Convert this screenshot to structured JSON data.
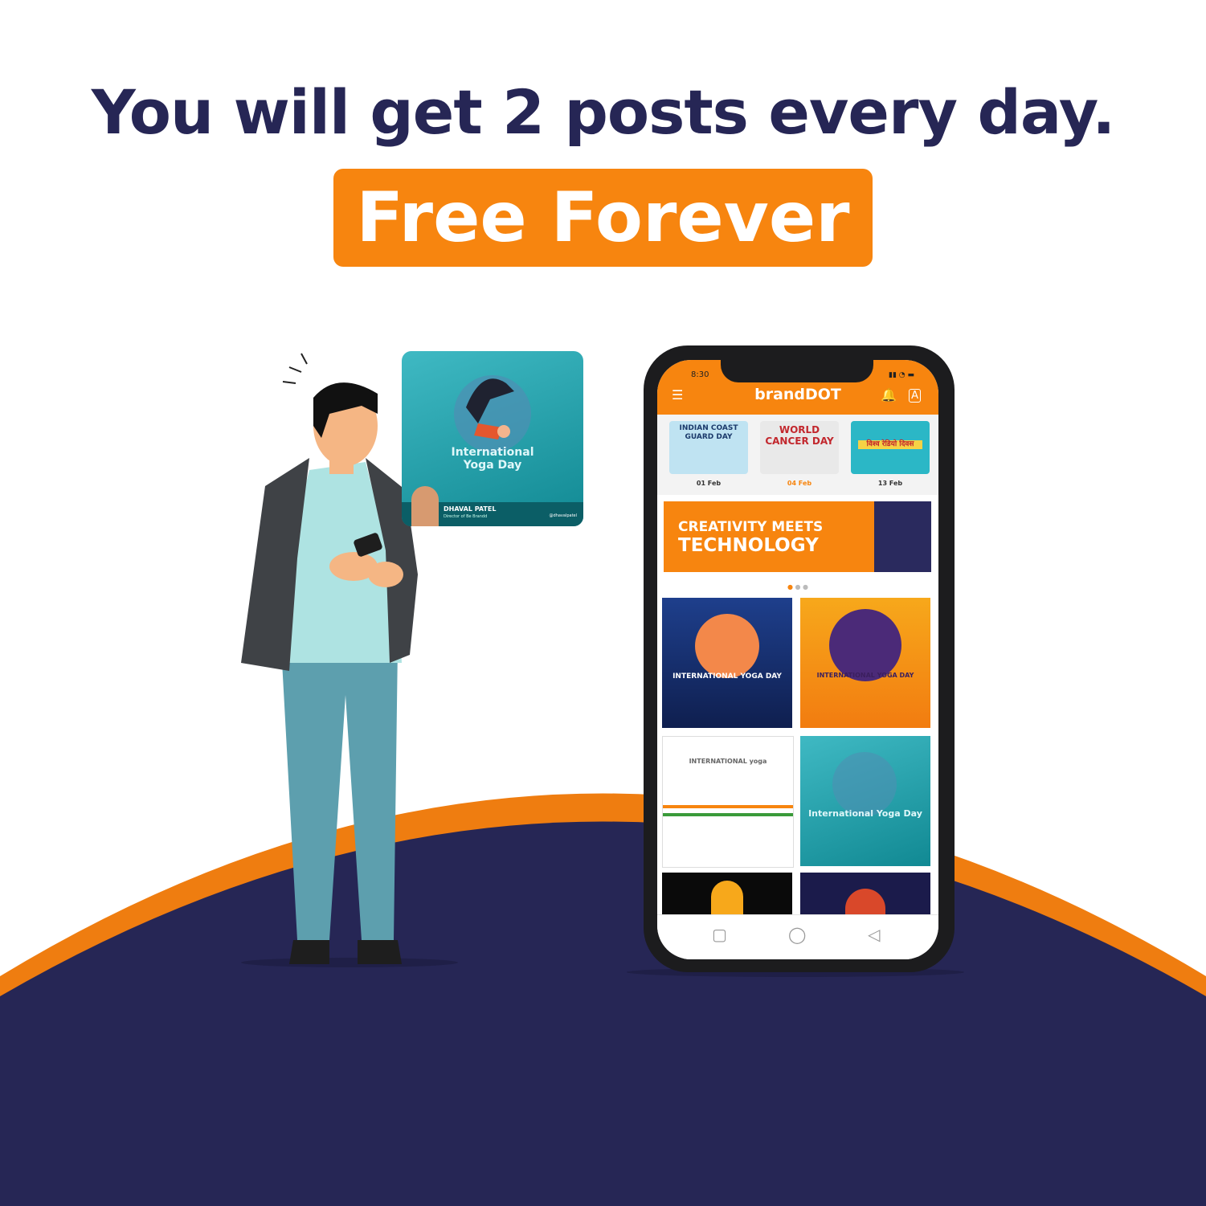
{
  "headline": "You will get 2 posts every day.",
  "badge": "Free Forever",
  "colors": {
    "navy": "#262655",
    "orange": "#f7850f"
  },
  "popup_post": {
    "title_line1": "International",
    "title_line2": "Yoga Day",
    "name": "DHAVAL PATEL",
    "role": "Director of Be Brandd",
    "handle": "@dhavalpatel"
  },
  "phone": {
    "status_time": "8:30",
    "app_title": "brandDOT",
    "menu_icon": "menu-icon",
    "bell_icon": "bell-icon",
    "translate_icon": "translate-icon",
    "categories": [
      {
        "label": "INDIAN COAST GUARD DAY",
        "date": "01 Feb"
      },
      {
        "label": "WORLD CANCER DAY",
        "date": "04 Feb"
      },
      {
        "label": "विश्व रेडियो दिवस",
        "date": "13 Feb"
      }
    ],
    "banner_line1": "CREATIVITY MEETS",
    "banner_line2": "TECHNOLOGY",
    "posts": [
      {
        "text": "INTERNATIONAL YOGA DAY"
      },
      {
        "text": "INTERNATIONAL YOGA DAY"
      },
      {
        "text": "INTERNATIONAL yoga"
      },
      {
        "text": "International Yoga Day"
      }
    ],
    "nav": [
      "square-nav-icon",
      "circle-nav-icon",
      "back-nav-icon"
    ]
  }
}
